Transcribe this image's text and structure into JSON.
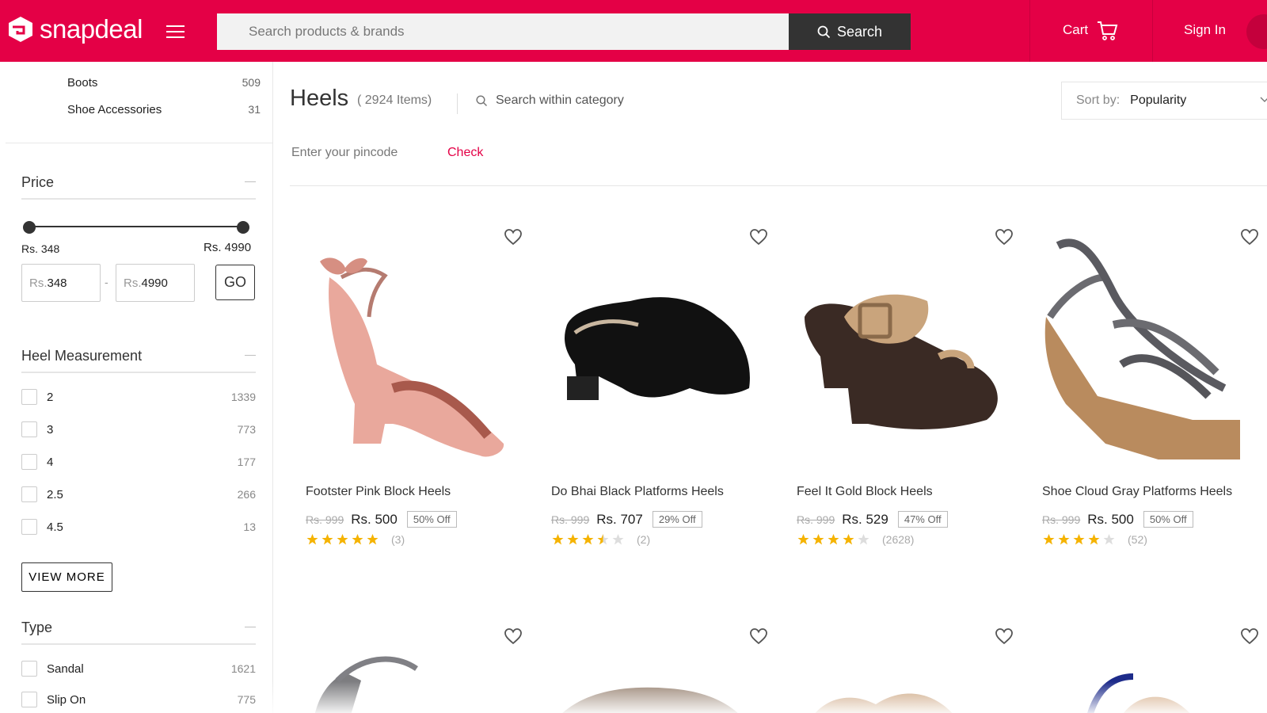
{
  "header": {
    "logo_text": "snapdeal",
    "search_placeholder": "Search products & brands",
    "search_label": "Search",
    "cart_label": "Cart",
    "signin_label": "Sign In",
    "brand_color": "#e40046"
  },
  "sidebar": {
    "categories": [
      {
        "label": "Boots",
        "count": "509"
      },
      {
        "label": "Shoe Accessories",
        "count": "31"
      }
    ],
    "price": {
      "title": "Price",
      "collapse": "—",
      "min_label": "Rs. 348",
      "max_label": "Rs. 4990",
      "currency": "Rs.",
      "min_value": "348",
      "max_value": "4990",
      "range_fraction": [
        0.0,
        1.0
      ],
      "go_label": "GO",
      "separator": "-"
    },
    "heel": {
      "title": "Heel Measurement",
      "collapse": "—",
      "options": [
        {
          "label": "2",
          "count": "1339"
        },
        {
          "label": "3",
          "count": "773"
        },
        {
          "label": "4",
          "count": "177"
        },
        {
          "label": "2.5",
          "count": "266"
        },
        {
          "label": "4.5",
          "count": "13"
        }
      ],
      "view_more": "VIEW MORE"
    },
    "type": {
      "title": "Type",
      "collapse": "—",
      "options": [
        {
          "label": "Sandal",
          "count": "1621"
        },
        {
          "label": "Slip On",
          "count": "775"
        }
      ]
    }
  },
  "main": {
    "title": "Heels",
    "item_count": "( 2924 Items)",
    "search_within": "Search within category",
    "sort_key": "Sort by:",
    "sort_value": "Popularity",
    "pincode_placeholder": "Enter your pincode",
    "check_label": "Check",
    "products": [
      {
        "name": "Footster Pink Block Heels",
        "old_price": "Rs. 999",
        "price": "Rs. 500",
        "discount": "50% Off",
        "rating": 5,
        "reviews": "(3)"
      },
      {
        "name": "Do Bhai Black Platforms Heels",
        "old_price": "Rs. 999",
        "price": "Rs. 707",
        "discount": "29% Off",
        "rating": 3.5,
        "reviews": "(2)"
      },
      {
        "name": "Feel It Gold Block Heels",
        "old_price": "Rs. 999",
        "price": "Rs. 529",
        "discount": "47% Off",
        "rating": 4,
        "reviews": "(2628)"
      },
      {
        "name": "Shoe Cloud Gray Platforms Heels",
        "old_price": "Rs. 999",
        "price": "Rs. 500",
        "discount": "50% Off",
        "rating": 4,
        "reviews": "(52)"
      }
    ],
    "star_color": "#f5b301"
  }
}
